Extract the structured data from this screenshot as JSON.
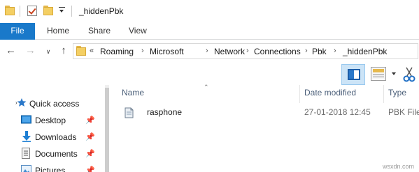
{
  "window": {
    "title": "_hiddenPbk"
  },
  "ribbon": {
    "tabs": [
      "File",
      "Home",
      "Share",
      "View"
    ]
  },
  "address": {
    "overflow": "«",
    "crumbs": [
      "Roaming",
      "Microsoft",
      "Network",
      "Connections",
      "Pbk",
      "_hiddenPbk"
    ],
    "separator": "›"
  },
  "nav": {
    "back": "←",
    "forward": "→",
    "recent": "∨",
    "up": "↑",
    "chevron": "›",
    "pin": "📌",
    "items": [
      {
        "label": "Quick access",
        "icon": "star-icon"
      },
      {
        "label": "Desktop",
        "icon": "desktop-icon"
      },
      {
        "label": "Downloads",
        "icon": "download-arrow-icon"
      },
      {
        "label": "Documents",
        "icon": "document-icon"
      },
      {
        "label": "Pictures",
        "icon": "pictures-icon"
      }
    ]
  },
  "columns": {
    "name": "Name",
    "date_modified": "Date modified",
    "type": "Type"
  },
  "files": [
    {
      "name": "rasphone",
      "date_modified": "27-01-2018 12:45",
      "type": "PBK File",
      "icon": "phonebook-file-icon"
    }
  ],
  "watermark": "wsxdn.com",
  "colors": {
    "file_tab": "#1979ca",
    "folder": "#f4cf63",
    "selected_tool": "#cce4f7",
    "column_header": "#4c607a"
  }
}
